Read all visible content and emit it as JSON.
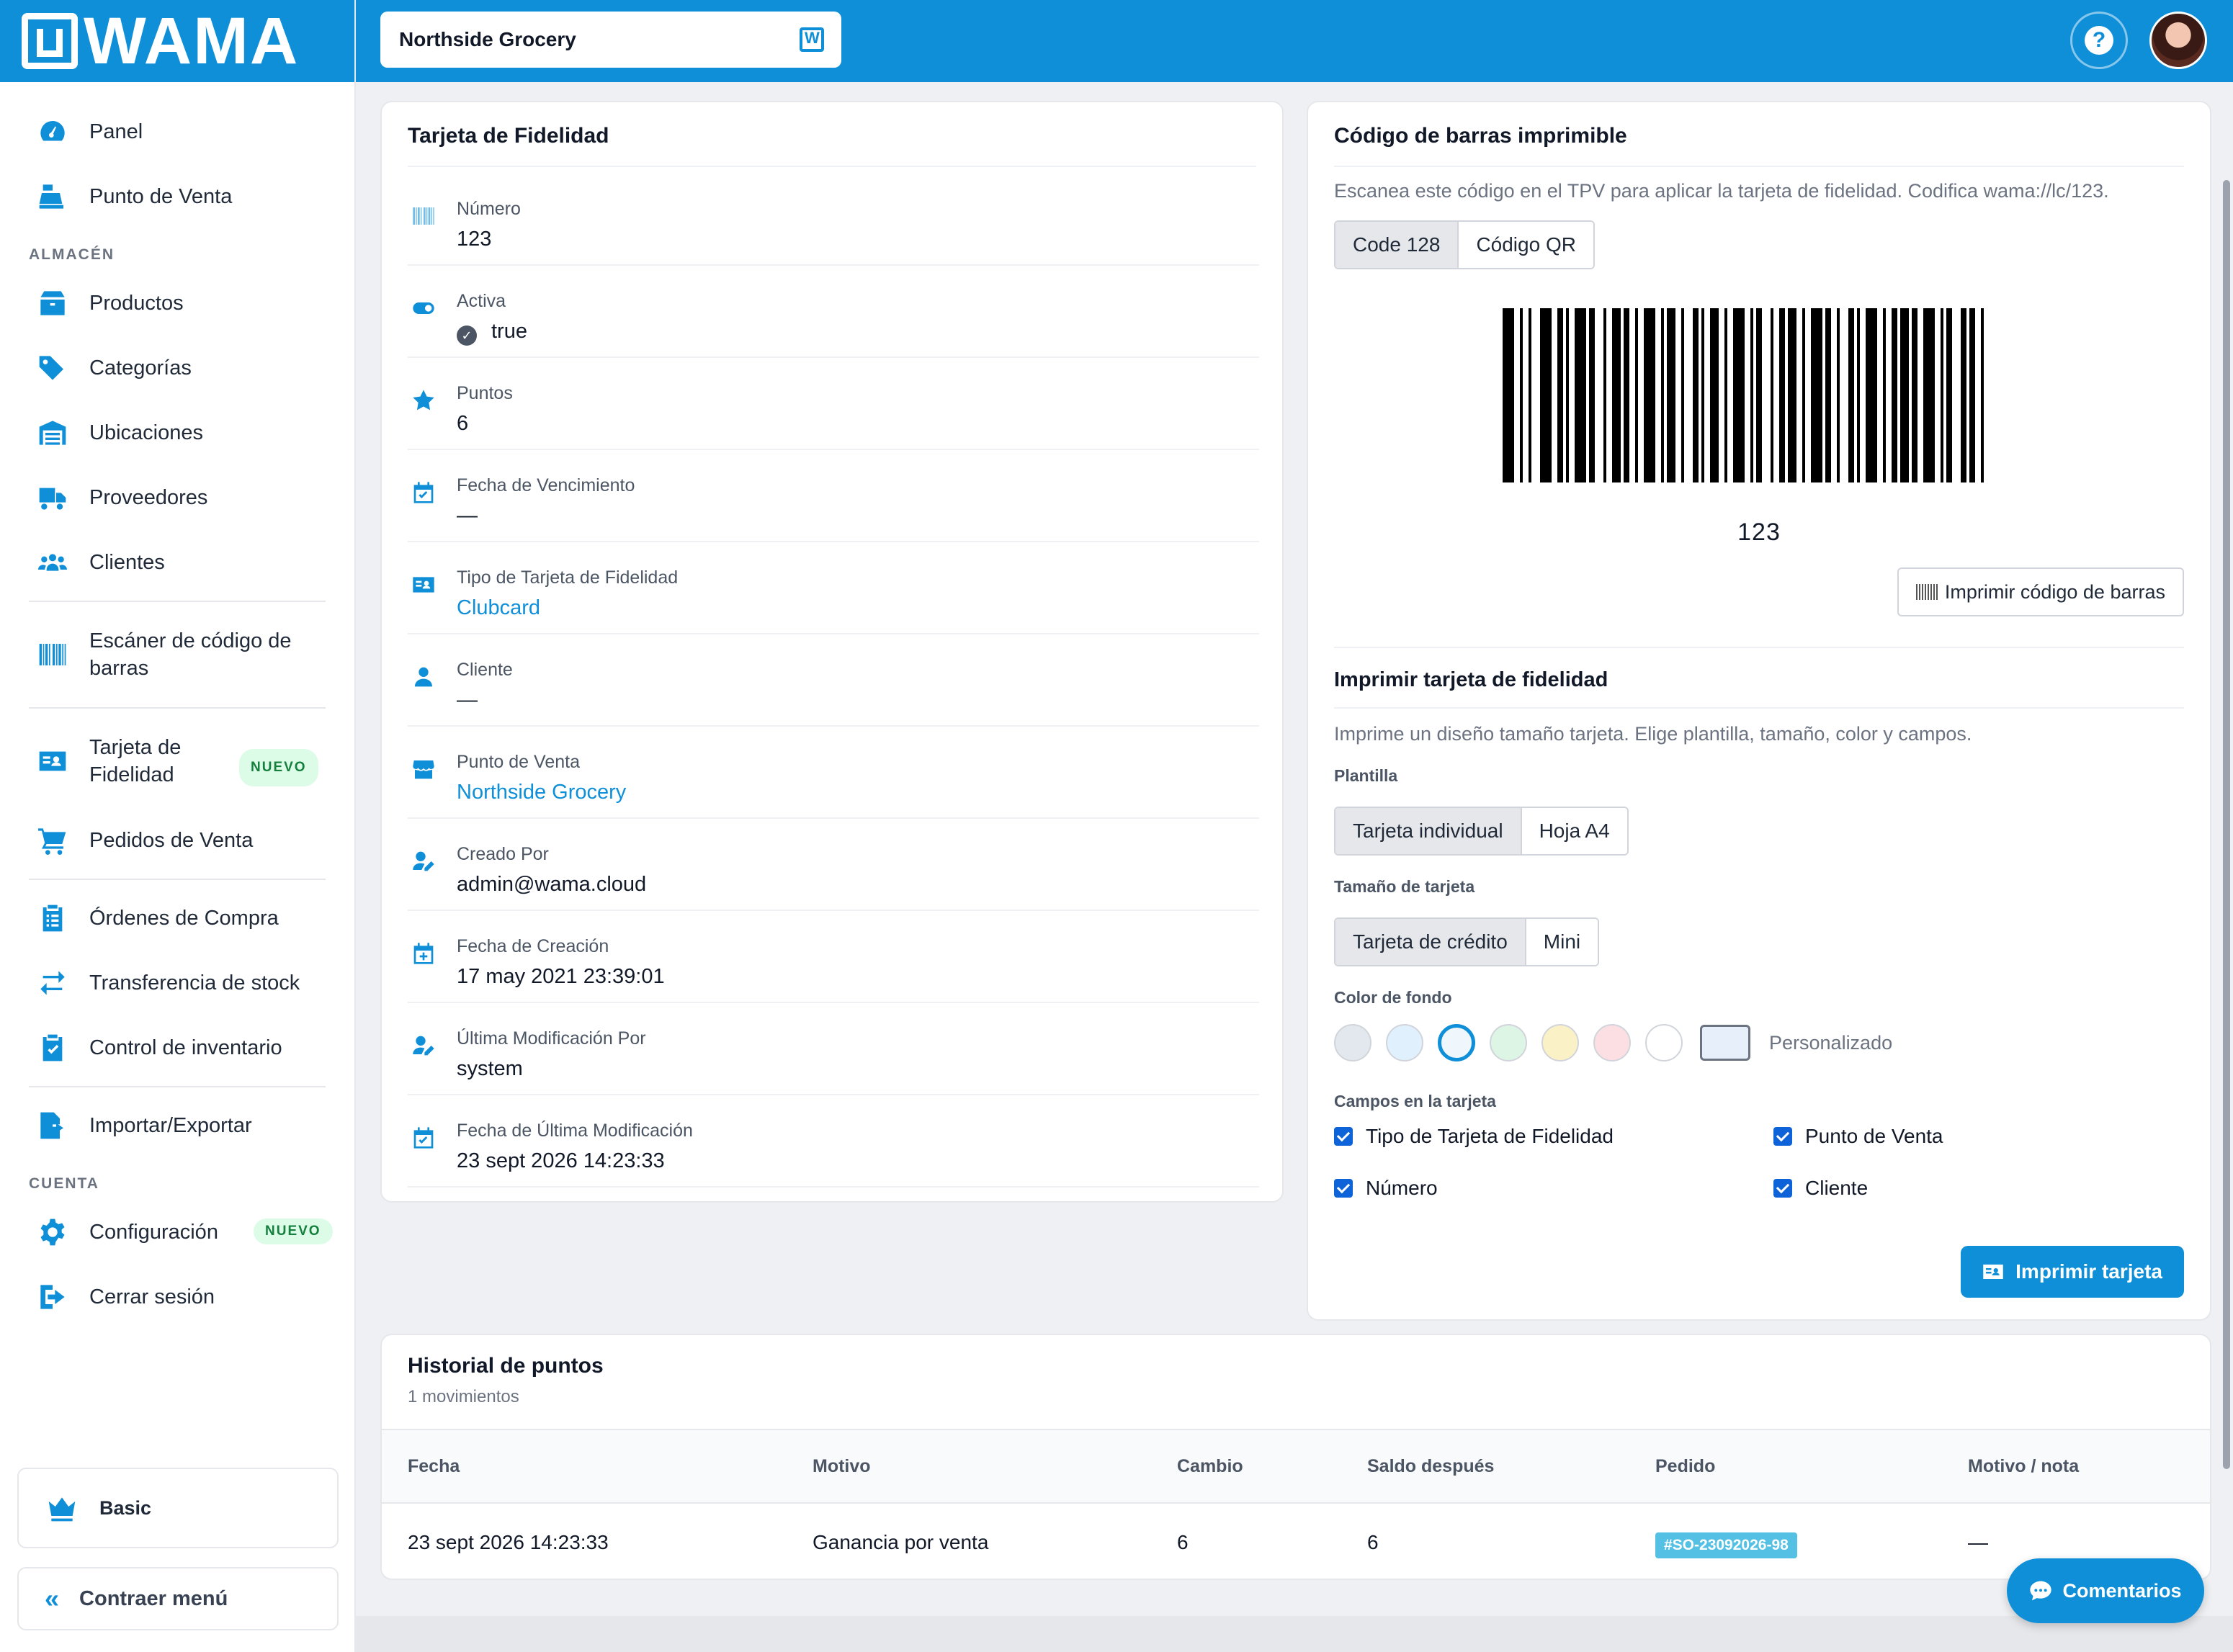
{
  "brand": {
    "logo_text": "WAMA"
  },
  "sidebar": {
    "items_top": [
      {
        "label": "Panel",
        "icon": "gauge-icon"
      },
      {
        "label": "Punto de Venta",
        "icon": "cash-register-icon"
      }
    ],
    "section_almacen": "ALMACÉN",
    "items_almacen": [
      {
        "label": "Productos",
        "icon": "box-icon"
      },
      {
        "label": "Categorías",
        "icon": "tags-icon"
      },
      {
        "label": "Ubicaciones",
        "icon": "warehouse-icon"
      },
      {
        "label": "Proveedores",
        "icon": "truck-icon"
      },
      {
        "label": "Clientes",
        "icon": "users-icon"
      }
    ],
    "scanner_label": "Escáner de código de barras",
    "loyalty_label": "Tarjeta de Fidelidad",
    "loyalty_badge": "NUEVO",
    "orders_label": "Pedidos de Venta",
    "items_stock": [
      {
        "label": "Órdenes de Compra",
        "icon": "clipboard-list-icon"
      },
      {
        "label": "Transferencia de stock",
        "icon": "exchange-icon"
      },
      {
        "label": "Control de inventario",
        "icon": "clipboard-check-icon"
      }
    ],
    "import_label": "Importar/Exportar",
    "section_cuenta": "CUENTA",
    "settings_label": "Configuración",
    "settings_badge": "NUEVO",
    "logout_label": "Cerrar sesión",
    "plan_label": "Basic",
    "collapse_label": "Contraer menú"
  },
  "topbar": {
    "store_name": "Northside Grocery",
    "help_symbol": "?"
  },
  "detail": {
    "title": "Tarjeta de Fidelidad",
    "fields": [
      {
        "label": "Número",
        "value": "123",
        "icon": "barcode-icon",
        "link": false
      },
      {
        "label": "Activa",
        "value": "true",
        "icon": "toggle-icon",
        "link": false,
        "check": true
      },
      {
        "label": "Puntos",
        "value": "6",
        "icon": "star-icon",
        "link": false
      },
      {
        "label": "Fecha de Vencimiento",
        "value": "—",
        "icon": "calendar-check-icon",
        "link": false
      },
      {
        "label": "Tipo de Tarjeta de Fidelidad",
        "value": "Clubcard",
        "icon": "id-card-icon",
        "link": true
      },
      {
        "label": "Cliente",
        "value": "—",
        "icon": "user-icon",
        "link": false
      },
      {
        "label": "Punto de Venta",
        "value": "Northside Grocery",
        "icon": "store-icon",
        "link": true
      },
      {
        "label": "Creado Por",
        "value": "admin@wama.cloud",
        "icon": "user-edit-icon",
        "link": false
      },
      {
        "label": "Fecha de Creación",
        "value": "17 may 2021 23:39:01",
        "icon": "calendar-plus-icon",
        "link": false
      },
      {
        "label": "Última Modificación Por",
        "value": "system",
        "icon": "user-edit-icon",
        "link": false
      },
      {
        "label": "Fecha de Última Modificación",
        "value": "23 sept 2026 14:23:33",
        "icon": "calendar-check-icon",
        "link": false
      }
    ]
  },
  "barcode": {
    "title": "Código de barras imprimible",
    "description": "Escanea este código en el TPV para aplicar la tarjeta de fidelidad. Codifica wama://lc/123.",
    "tabs": [
      "Code 128",
      "Código QR"
    ],
    "active_tab": "Code 128",
    "number": "123",
    "print_button": "Imprimir código de barras"
  },
  "print_card": {
    "title": "Imprimir tarjeta de fidelidad",
    "description": "Imprime un diseño tamaño tarjeta. Elige plantilla, tamaño, color y campos.",
    "template_label": "Plantilla",
    "templates": [
      "Tarjeta individual",
      "Hoja A4"
    ],
    "size_label": "Tamaño de tarjeta",
    "sizes": [
      "Tarjeta de crédito",
      "Mini"
    ],
    "color_label": "Color de fondo",
    "colors": [
      "#e3e8ef",
      "#e0f0fd",
      "#f0f7fc",
      "#dcf5e4",
      "#fbf1c7",
      "#fbdfe2",
      "#ffffff"
    ],
    "selected_color_index": 2,
    "custom_color": "#e6effa",
    "custom_label": "Personalizado",
    "fields_label": "Campos en la tarjeta",
    "fields": [
      {
        "label": "Tipo de Tarjeta de Fidelidad",
        "checked": true
      },
      {
        "label": "Punto de Venta",
        "checked": true
      },
      {
        "label": "Número",
        "checked": true
      },
      {
        "label": "Cliente",
        "checked": true
      }
    ],
    "print_button": "Imprimir tarjeta"
  },
  "history": {
    "title": "Historial de puntos",
    "count_text": "1 movimientos",
    "columns": [
      "Fecha",
      "Motivo",
      "Cambio",
      "Saldo después",
      "Pedido",
      "Motivo / nota"
    ],
    "rows": [
      {
        "date": "23 sept 2026 14:23:33",
        "reason": "Ganancia por venta",
        "change": "6",
        "balance": "6",
        "order": "#SO-23092026-98",
        "note": "—"
      }
    ]
  },
  "chat": {
    "label": "Comentarios"
  },
  "colors": {
    "accent": "#0f8fd8",
    "checkbox": "#0f63d8",
    "tag": "#54c1e4"
  }
}
